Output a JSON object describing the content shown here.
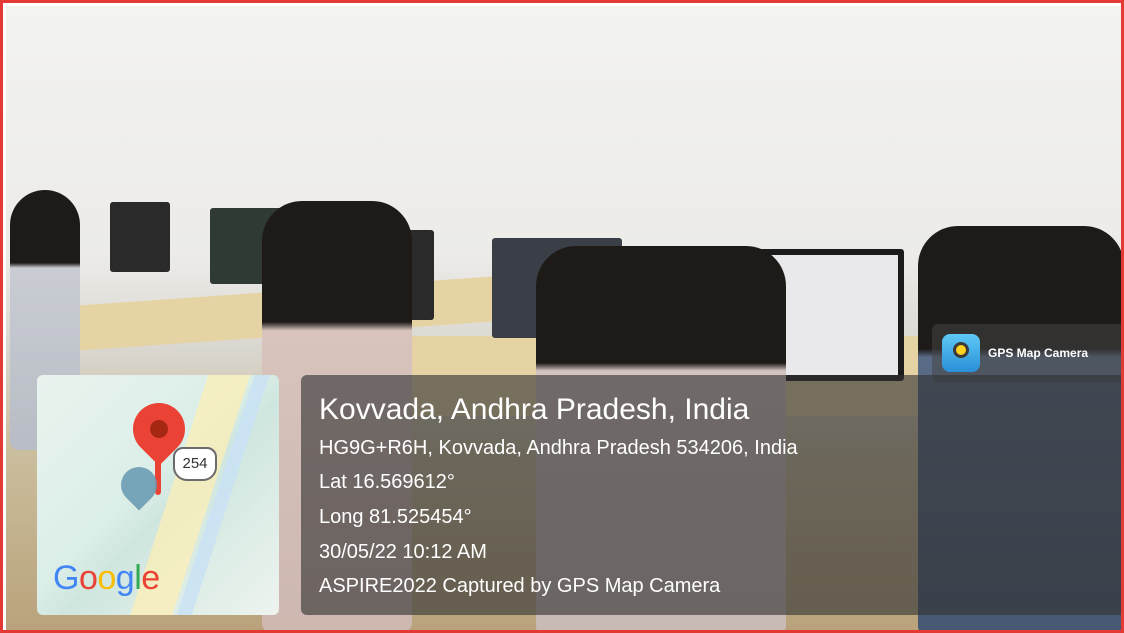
{
  "badge": {
    "label": "GPS Map Camera"
  },
  "map": {
    "highway_shield": "254",
    "logo_text": "Google"
  },
  "info": {
    "title": "Kovvada, Andhra Pradesh, India",
    "address": "HG9G+R6H, Kovvada, Andhra Pradesh 534206, India",
    "lat": "Lat 16.569612°",
    "long": "Long 81.525454°",
    "datetime": "30/05/22 10:12 AM",
    "caption": "ASPIRE2022 Captured by GPS Map Camera"
  },
  "colors": {
    "frame_border": "#e53935",
    "pin": "#ea4335"
  }
}
